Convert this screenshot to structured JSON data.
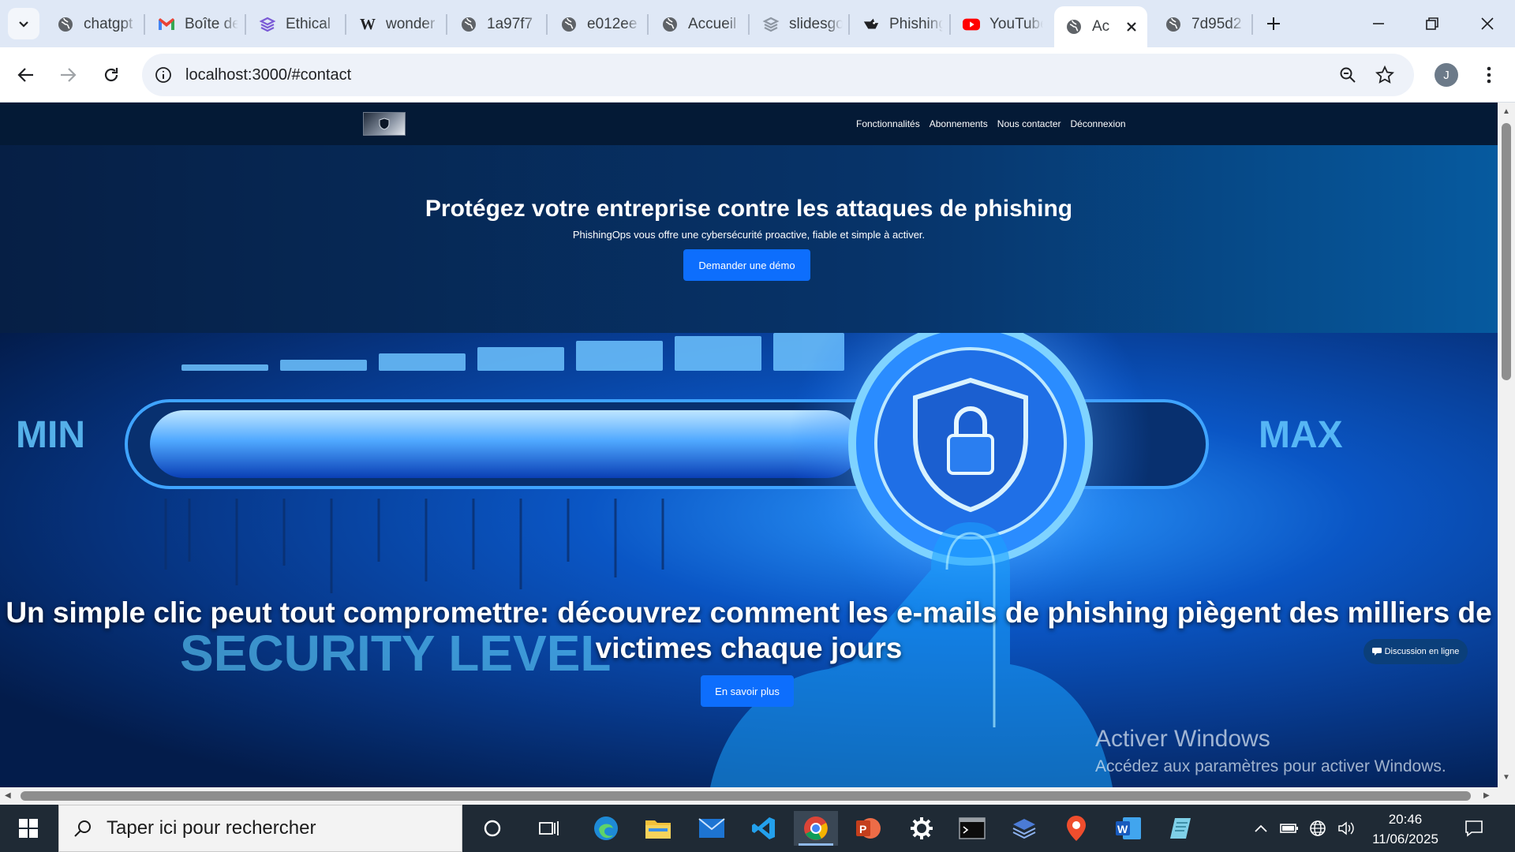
{
  "browser": {
    "tabs": [
      {
        "title": "chatgpt",
        "icon": "globe-icon"
      },
      {
        "title": "Boîte de réception",
        "icon": "gmail-icon"
      },
      {
        "title": "Ethical",
        "icon": "stack-icon"
      },
      {
        "title": "wonder",
        "icon": "w-icon"
      },
      {
        "title": "1a97f7",
        "icon": "globe-icon"
      },
      {
        "title": "e012ee",
        "icon": "globe-icon"
      },
      {
        "title": "Accueil",
        "icon": "globe-icon"
      },
      {
        "title": "slidesgo",
        "icon": "stack-icon"
      },
      {
        "title": "Phishing",
        "icon": "phishing-icon"
      },
      {
        "title": "YouTube",
        "icon": "youtube-icon"
      },
      {
        "title": "Ac",
        "icon": "globe-icon",
        "active": true
      },
      {
        "title": "7d95d2",
        "icon": "globe-icon"
      }
    ],
    "url": "localhost:3000/#contact",
    "profile_initial": "J"
  },
  "site": {
    "nav_links": [
      "Fonctionnalités",
      "Abonnements",
      "Nous contacter",
      "Déconnexion"
    ],
    "hero_title": "Protégez votre entreprise contre les attaques de phishing",
    "hero_subtitle": "PhishingOps vous offre une cybersécurité proactive, fiable et simple à activer.",
    "hero_button": "Demander une démo",
    "banner_title": "Un simple clic peut tout compromettre: découvrez comment les e-mails de phishing piègent des milliers de victimes chaque jours",
    "banner_button": "En savoir plus",
    "banner_image_text": {
      "min": "MIN",
      "max": "MAX",
      "level": "SECURITY LEVEL"
    },
    "chat_button": "Discussion en ligne"
  },
  "windows": {
    "activation_title": "Activer Windows",
    "activation_text": "Accédez aux paramètres pour activer Windows.",
    "search_placeholder": "Taper ici pour rechercher",
    "time": "20:46",
    "date": "11/06/2025"
  },
  "colors": {
    "accent": "#0d6efd",
    "nav_bg": "#041a36",
    "taskbar": "#1f2a35"
  }
}
